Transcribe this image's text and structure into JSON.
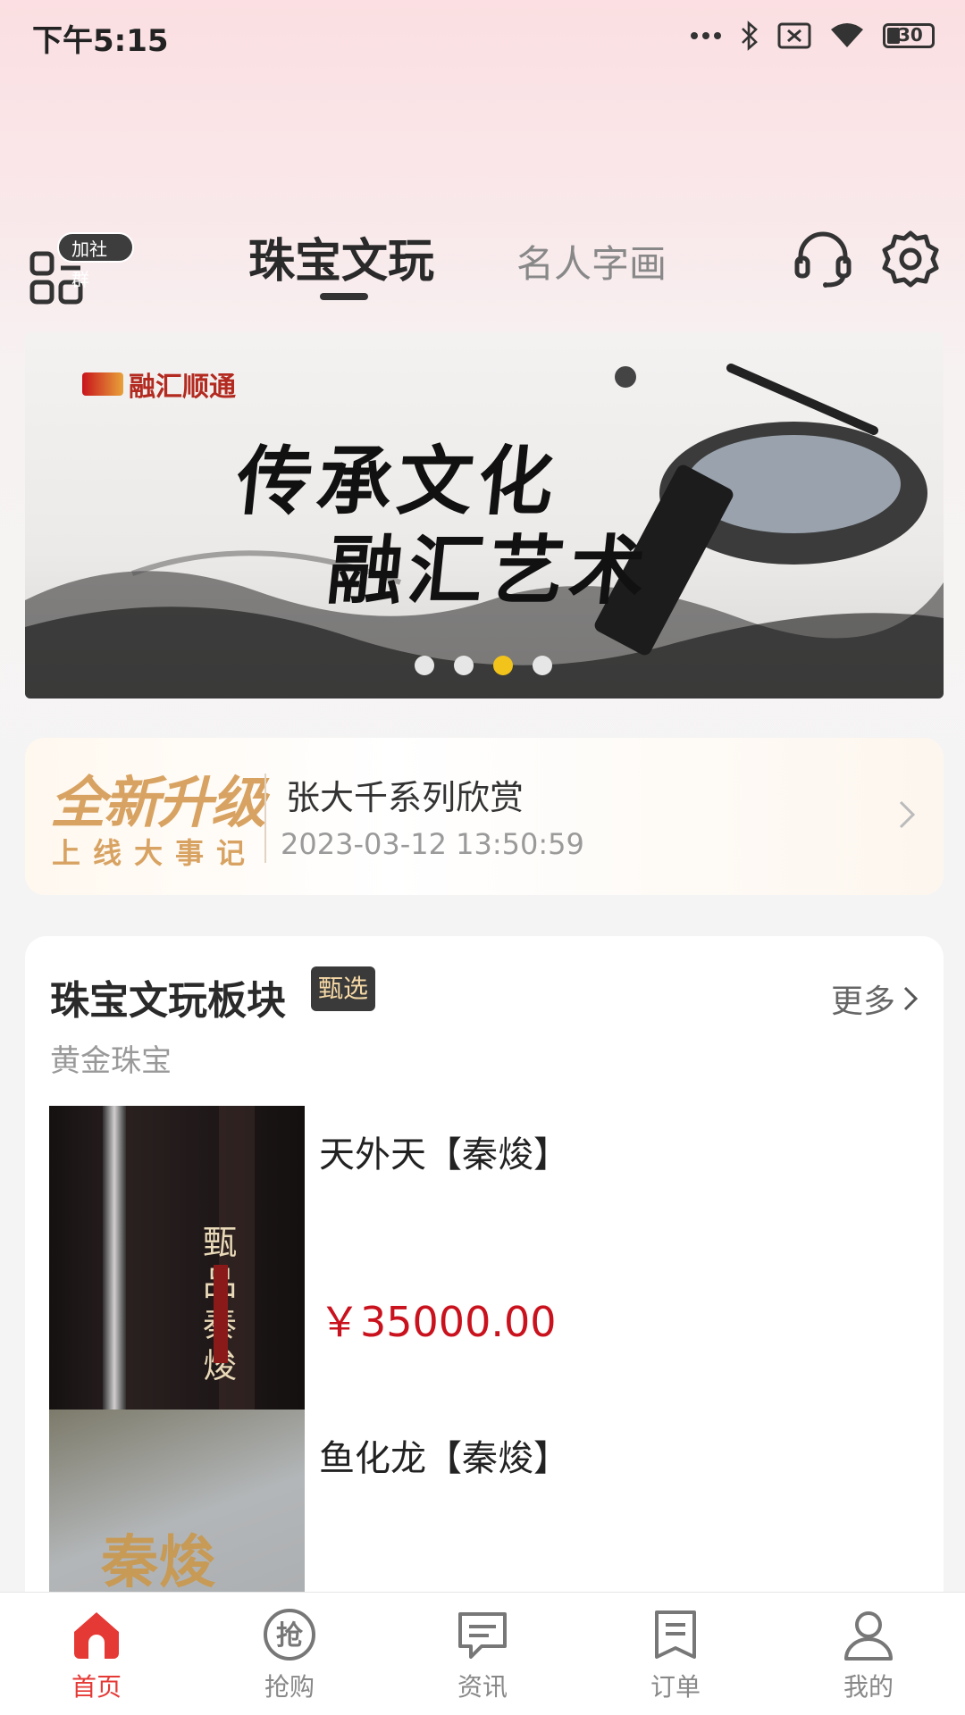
{
  "status_bar": {
    "time": "下午5:15",
    "battery": "30"
  },
  "header": {
    "group_badge": "加社群",
    "tabs": [
      {
        "label": "珠宝文玩",
        "active": true
      },
      {
        "label": "名人字画",
        "active": false
      }
    ],
    "icons": [
      "headset-icon",
      "settings-gear-icon"
    ]
  },
  "banner": {
    "brand": "融汇顺通",
    "slogan_line1": "传承文化",
    "slogan_line2": "融汇艺术",
    "page_count": 4,
    "active_index": 2
  },
  "news": {
    "tag_line1": "全新升级",
    "tag_line2": "上线大事记",
    "title": "张大千系列欣赏",
    "time": "2023-03-12 13:50:59"
  },
  "section": {
    "title": "珠宝文玩板块",
    "badge": "甄选",
    "more_label": "更多",
    "subtitle": "黄金珠宝",
    "products": [
      {
        "name": "天外天【秦焌】",
        "price": "￥35000.00",
        "image_text": "甄品秦焌"
      },
      {
        "name": "鱼化龙【秦焌】",
        "price": "",
        "image_text": "秦焌"
      }
    ]
  },
  "bottom_nav": {
    "items": [
      {
        "label": "首页",
        "icon": "home-icon",
        "active": true
      },
      {
        "label": "抢购",
        "icon": "flash-buy-icon",
        "active": false
      },
      {
        "label": "资讯",
        "icon": "news-message-icon",
        "active": false
      },
      {
        "label": "订单",
        "icon": "order-icon",
        "active": false
      },
      {
        "label": "我的",
        "icon": "profile-icon",
        "active": false
      }
    ]
  },
  "colors": {
    "accent": "#e53935",
    "price": "#c9121d",
    "gold": "#d8a362",
    "dot_active": "#f2c31a"
  }
}
